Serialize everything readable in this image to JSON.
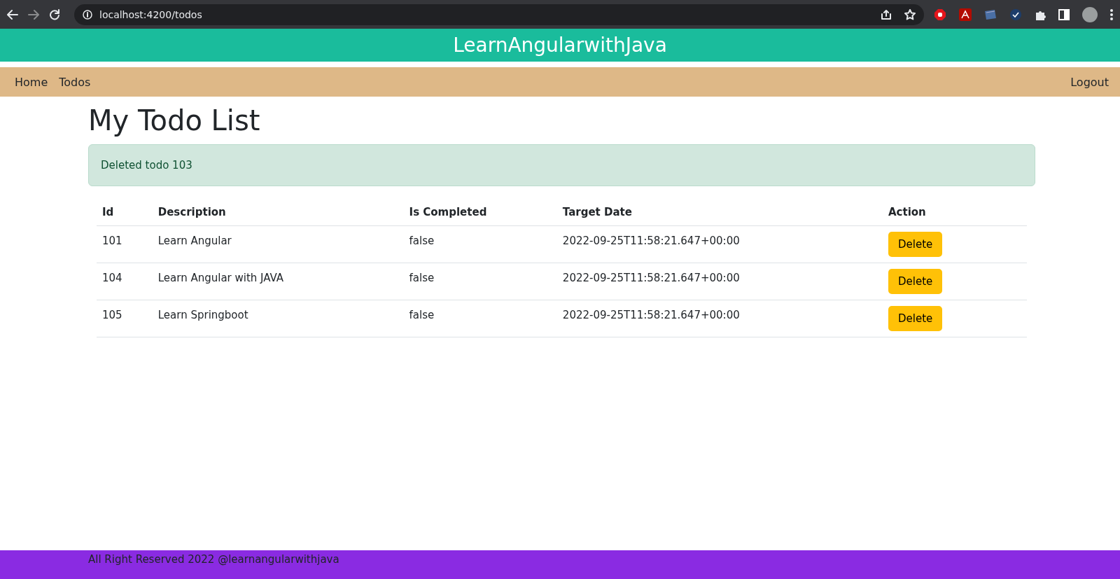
{
  "browser": {
    "url": "localhost:4200/todos"
  },
  "header": {
    "title": "LearnAngularwithJava"
  },
  "nav": {
    "left": [
      "Home",
      "Todos"
    ],
    "right": [
      "Logout"
    ]
  },
  "page": {
    "heading": "My Todo List",
    "alert": "Deleted todo 103",
    "table": {
      "columns": [
        "Id",
        "Description",
        "Is Completed",
        "Target Date",
        "Action"
      ],
      "rows": [
        {
          "id": "101",
          "description": "Learn Angular",
          "is_completed": "false",
          "target_date": "2022-09-25T11:58:21.647+00:00",
          "action": "Delete"
        },
        {
          "id": "104",
          "description": "Learn Angular with JAVA",
          "is_completed": "false",
          "target_date": "2022-09-25T11:58:21.647+00:00",
          "action": "Delete"
        },
        {
          "id": "105",
          "description": "Learn Springboot",
          "is_completed": "false",
          "target_date": "2022-09-25T11:58:21.647+00:00",
          "action": "Delete"
        }
      ]
    }
  },
  "footer": {
    "text": "All Right Reserved 2022 @learnangularwithjava"
  }
}
